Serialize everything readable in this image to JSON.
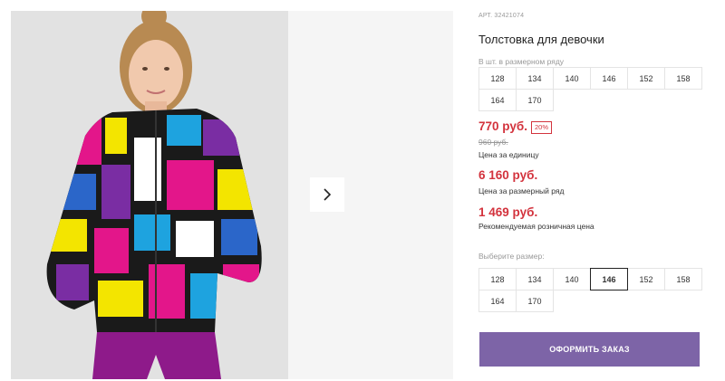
{
  "product": {
    "sku": "АРТ. 32421074",
    "title": "Толстовка для девочки",
    "photo_alt_icon": "product-photo"
  },
  "gallery": {
    "next_icon": "chevron-right-icon"
  },
  "size_range": {
    "label": "В шт. в размерном ряду",
    "sizes": [
      "128",
      "134",
      "140",
      "146",
      "152",
      "158",
      "164",
      "170"
    ]
  },
  "prices": {
    "unit_price": "770 руб.",
    "discount": "20%",
    "old_price": "960 руб.",
    "unit_label": "Цена за единицу",
    "range_price": "6 160 руб.",
    "range_label": "Цена за размерный ряд",
    "retail_price": "1 469 руб.",
    "retail_label": "Рекомендуемая розничная цена"
  },
  "size_select": {
    "label": "Выберите размер:",
    "sizes": [
      "128",
      "134",
      "140",
      "146",
      "152",
      "158",
      "164",
      "170"
    ],
    "selected": "146"
  },
  "order": {
    "button_label": "ОФОРМИТЬ ЗАКАЗ"
  },
  "colors": {
    "accent": "#7d64a7",
    "price_red": "#d3333d"
  }
}
